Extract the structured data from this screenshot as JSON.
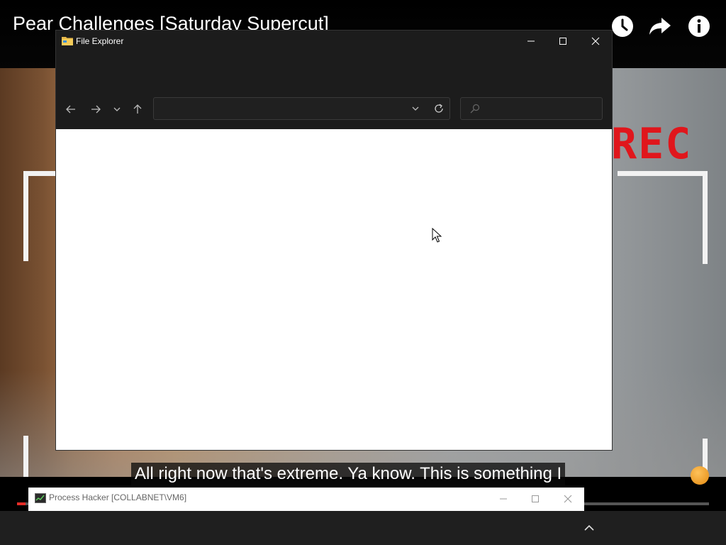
{
  "youtube": {
    "title": "Pear Challenges [Saturday Supercut]",
    "icons": [
      "watch-later-icon",
      "share-icon",
      "info-icon"
    ],
    "subtitle": "All right now that's extreme. Ya know. This is something I",
    "overlay_text": "REC",
    "progress_fraction": 0.012,
    "accent_color": "#e52d27"
  },
  "file_explorer": {
    "title": "File Explorer",
    "address_value": "",
    "search_value": "",
    "theme_color": "#1c1c1c"
  },
  "process_hacker": {
    "title": "Process Hacker [COLLABNET\\VM6]"
  }
}
